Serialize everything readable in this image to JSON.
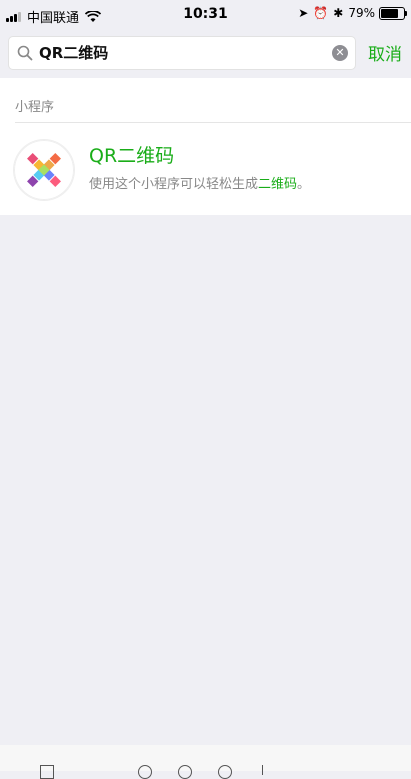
{
  "status_bar": {
    "carrier": "中国联通",
    "time": "10:31",
    "battery": "79%",
    "battery_level": 0.79
  },
  "search": {
    "query": "QR二维码",
    "cancel_label": "取消"
  },
  "results": {
    "section_title": "小程序",
    "items": [
      {
        "name": "QR二维码",
        "description_before": "使用这个小程序可以轻松生成",
        "description_highlight": "二维码",
        "description_after": "。"
      }
    ]
  },
  "colors": {
    "accent": "#1aad19",
    "background": "#efeff4"
  }
}
